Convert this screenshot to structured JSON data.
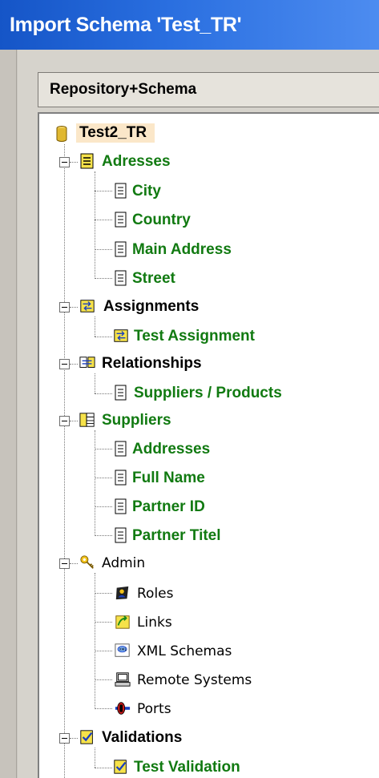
{
  "window": {
    "title": "Import Schema 'Test_TR'"
  },
  "panel": {
    "header": "Repository+Schema"
  },
  "tree": {
    "root": "Test2_TR",
    "adresses": {
      "label": "Adresses",
      "children": [
        "City",
        "Country",
        "Main Address",
        "Street"
      ]
    },
    "assignments": {
      "label": "Assignments",
      "children": [
        "Test Assignment"
      ]
    },
    "relationships": {
      "label": "Relationships",
      "children": [
        "Suppliers / Products"
      ]
    },
    "suppliers": {
      "label": "Suppliers",
      "children": [
        "Addresses",
        "Full Name",
        "Partner ID",
        "Partner Titel"
      ]
    },
    "admin": {
      "label": "Admin",
      "children": [
        "Roles",
        "Links",
        "XML Schemas",
        "Remote Systems",
        "Ports"
      ]
    },
    "validations": {
      "label": "Validations",
      "children": [
        "Test Validation"
      ]
    }
  },
  "colors": {
    "title_bar": "#1e5fd6",
    "green_text": "#117a11",
    "root_highlight": "#fbe7c9"
  }
}
